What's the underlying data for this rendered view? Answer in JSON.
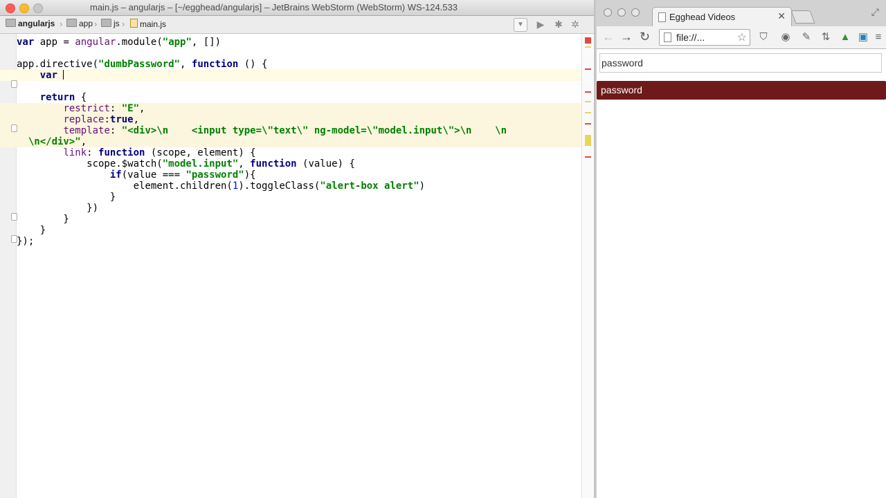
{
  "ide": {
    "window_title": "main.js – angularjs – [~/egghead/angularjs] – JetBrains WebStorm (WebStorm) WS-124.533",
    "breadcrumbs": [
      "angularjs",
      "app",
      "js",
      "main.js"
    ]
  },
  "code": [
    [
      [
        "var",
        "kw"
      ],
      [
        " app = ",
        ""
      ],
      [
        "angular",
        "prop"
      ],
      [
        ".module(",
        ""
      ],
      [
        "\"app\"",
        "str"
      ],
      [
        ", [])",
        ""
      ]
    ],
    [],
    [
      [
        "app.directive(",
        ""
      ],
      [
        "\"dumbPassword\"",
        "str"
      ],
      [
        ", ",
        ""
      ],
      [
        "function",
        "kw"
      ],
      [
        " () {",
        ""
      ]
    ],
    [
      [
        "    ",
        ""
      ],
      [
        "var",
        "kw"
      ],
      [
        " ",
        ""
      ]
    ],
    [],
    [
      [
        "    ",
        ""
      ],
      [
        "return",
        "kw"
      ],
      [
        " {",
        ""
      ]
    ],
    [
      [
        "        ",
        ""
      ],
      [
        "restrict",
        "prop"
      ],
      [
        ": ",
        ""
      ],
      [
        "\"E\"",
        "str"
      ],
      [
        ",",
        ""
      ]
    ],
    [
      [
        "        ",
        ""
      ],
      [
        "replace",
        "prop"
      ],
      [
        ":",
        ""
      ],
      [
        "true",
        "kw"
      ],
      [
        ",",
        ""
      ]
    ],
    [
      [
        "        ",
        ""
      ],
      [
        "template",
        "prop"
      ],
      [
        ": ",
        ""
      ],
      [
        "\"<div>\\n    <input type=\\\"text\\\" ng-model=\\\"model.input\\\">\\n    \\n",
        "str"
      ]
    ],
    [
      [
        "  ",
        ""
      ],
      [
        "\\n</div>\"",
        "str"
      ],
      [
        ",",
        ""
      ]
    ],
    [
      [
        "        ",
        ""
      ],
      [
        "link",
        "prop"
      ],
      [
        ": ",
        ""
      ],
      [
        "function",
        "kw"
      ],
      [
        " (scope, element) {",
        ""
      ]
    ],
    [
      [
        "            scope.$watch(",
        ""
      ],
      [
        "\"model.input\"",
        "str"
      ],
      [
        ", ",
        ""
      ],
      [
        "function",
        "kw"
      ],
      [
        " (value) {",
        ""
      ]
    ],
    [
      [
        "                ",
        ""
      ],
      [
        "if",
        "kw"
      ],
      [
        "(value === ",
        ""
      ],
      [
        "\"password\"",
        "str"
      ],
      [
        "){",
        ""
      ]
    ],
    [
      [
        "                    element.children(",
        ""
      ],
      [
        "1",
        "num"
      ],
      [
        ").toggleClass(",
        ""
      ],
      [
        "\"alert-box alert\"",
        "str"
      ],
      [
        ")",
        ""
      ]
    ],
    [
      [
        "                }",
        ""
      ]
    ],
    [
      [
        "            })",
        ""
      ]
    ],
    [
      [
        "        }",
        ""
      ]
    ],
    [
      [
        "    }",
        ""
      ]
    ],
    [
      [
        "});",
        ""
      ]
    ]
  ],
  "browser": {
    "tab_title": "Egghead Videos",
    "url": "file://...",
    "input_value": "password",
    "alert_text": "password"
  },
  "colors": {
    "alert_bg": "#6e1a1a",
    "string": "#008000",
    "keyword": "#000080"
  }
}
